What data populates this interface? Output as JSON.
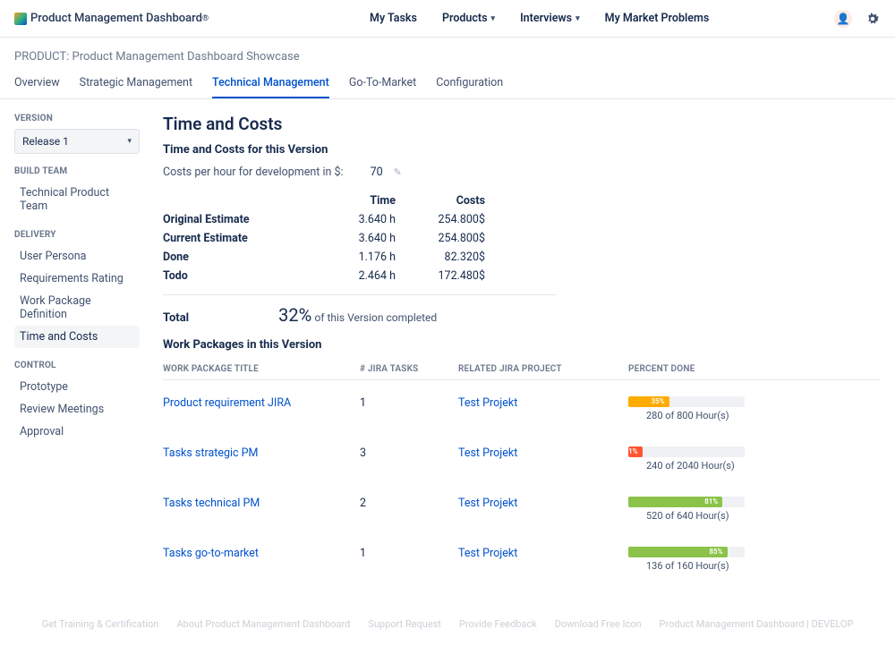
{
  "brand": "Product Management Dashboard",
  "brand_sup": "®",
  "nav": {
    "my_tasks": "My Tasks",
    "products": "Products",
    "interviews": "Interviews",
    "market": "My Market Problems"
  },
  "crumb": "PRODUCT: Product Management Dashboard Showcase",
  "tabs": {
    "overview": "Overview",
    "strategic": "Strategic Management",
    "technical": "Technical Management",
    "gtm": "Go-To-Market",
    "config": "Configuration"
  },
  "sidebar": {
    "version_hdr": "VERSION",
    "version_selected": "Release 1",
    "build_hdr": "BUILD TEAM",
    "build_item": "Technical Product Team",
    "delivery_hdr": "DELIVERY",
    "delivery": {
      "persona": "User Persona",
      "req": "Requirements Rating",
      "wpd": "Work Package Definition",
      "tc": "Time and Costs"
    },
    "control_hdr": "CONTROL",
    "control": {
      "proto": "Prototype",
      "review": "Review Meetings",
      "approval": "Approval"
    }
  },
  "page": {
    "title": "Time and Costs",
    "subtitle": "Time and Costs for this Version",
    "cph_label": "Costs per hour for development in $:",
    "cph_value": "70",
    "cols": {
      "time": "Time",
      "costs": "Costs"
    },
    "rows": {
      "orig": {
        "label": "Original Estimate",
        "time": "3.640 h",
        "cost": "254.800$"
      },
      "curr": {
        "label": "Current Estimate",
        "time": "3.640 h",
        "cost": "254.800$"
      },
      "done": {
        "label": "Done",
        "time": "1.176 h",
        "cost": "82.320$"
      },
      "todo": {
        "label": "Todo",
        "time": "2.464 h",
        "cost": "172.480$"
      }
    },
    "total_label": "Total",
    "pct": "32%",
    "pct_suffix": "of this Version completed",
    "wp_title": "Work Packages in this Version",
    "wp_cols": {
      "title": "WORK PACKAGE TITLE",
      "tasks": "# JIRA TASKS",
      "proj": "RELATED JIRA PROJECT",
      "pct": "PERCENT DONE"
    },
    "wp": [
      {
        "title": "Product requirement JIRA",
        "tasks": "1",
        "proj": "Test Projekt",
        "pct": "35%",
        "pct_w": "35%",
        "color": "#ffab00",
        "hours": "280 of 800 Hour(s)"
      },
      {
        "title": "Tasks strategic PM",
        "tasks": "3",
        "proj": "Test Projekt",
        "pct": "1%",
        "pct_w": "12%",
        "color": "#ff5630",
        "hours": "240 of 2040 Hour(s)"
      },
      {
        "title": "Tasks technical PM",
        "tasks": "2",
        "proj": "Test Projekt",
        "pct": "81%",
        "pct_w": "81%",
        "color": "#8bc34a",
        "hours": "520 of 640 Hour(s)"
      },
      {
        "title": "Tasks go-to-market",
        "tasks": "1",
        "proj": "Test Projekt",
        "pct": "85%",
        "pct_w": "85%",
        "color": "#8bc34a",
        "hours": "136 of 160 Hour(s)"
      }
    ]
  },
  "footer": [
    "Get Training & Certification",
    "About Product Management Dashboard",
    "Support Request",
    "Provide Feedback",
    "Download Free Icon",
    "Product Management Dashboard | DEVELOP"
  ]
}
